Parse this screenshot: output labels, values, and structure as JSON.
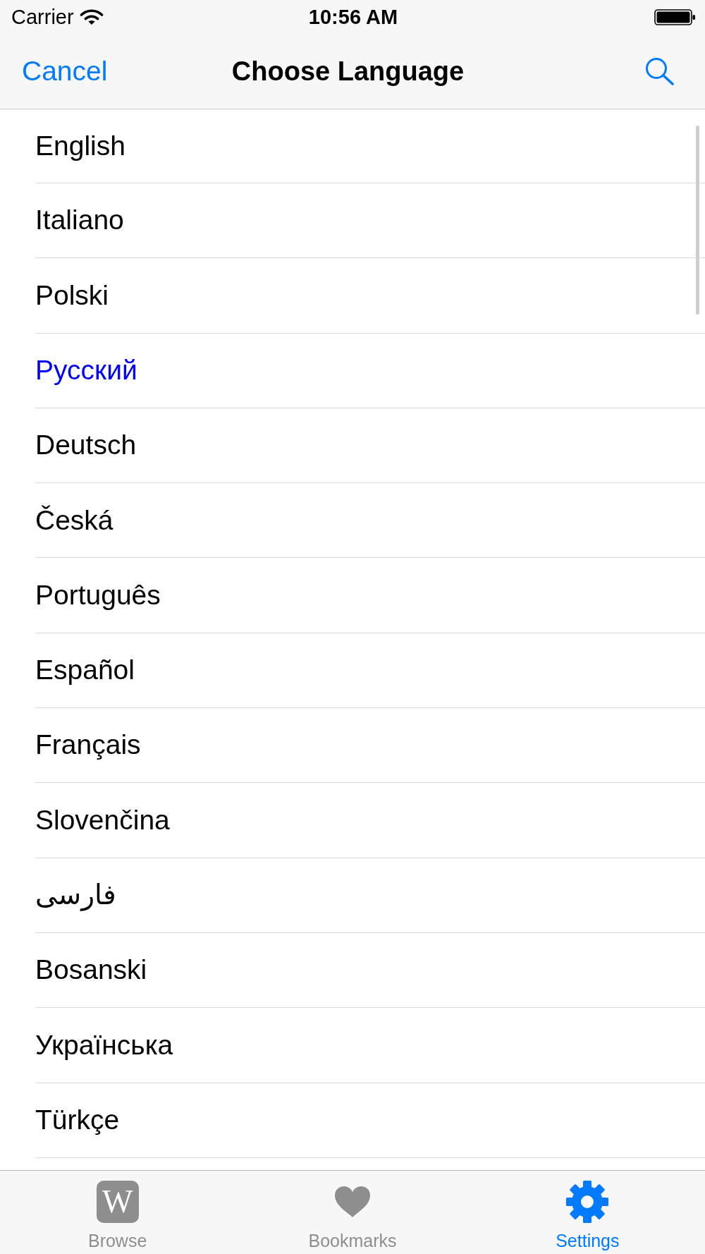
{
  "status_bar": {
    "carrier": "Carrier",
    "time": "10:56 AM"
  },
  "nav_bar": {
    "cancel_label": "Cancel",
    "title": "Choose Language"
  },
  "languages": [
    {
      "label": "English",
      "selected": false
    },
    {
      "label": "Italiano",
      "selected": false
    },
    {
      "label": "Polski",
      "selected": false
    },
    {
      "label": "Русский",
      "selected": true
    },
    {
      "label": "Deutsch",
      "selected": false
    },
    {
      "label": "Česká",
      "selected": false
    },
    {
      "label": "Português",
      "selected": false
    },
    {
      "label": "Español",
      "selected": false
    },
    {
      "label": "Français",
      "selected": false
    },
    {
      "label": "Slovenčina",
      "selected": false
    },
    {
      "label": "فارسی",
      "selected": false
    },
    {
      "label": "Bosanski",
      "selected": false
    },
    {
      "label": "Українська",
      "selected": false
    },
    {
      "label": "Türkçe",
      "selected": false
    }
  ],
  "tab_bar": [
    {
      "label": "Browse",
      "kind": "tile",
      "letter": "W",
      "selected": false
    },
    {
      "label": "Bookmarks",
      "kind": "heart",
      "selected": false
    },
    {
      "label": "Settings",
      "kind": "gear",
      "selected": true
    }
  ]
}
